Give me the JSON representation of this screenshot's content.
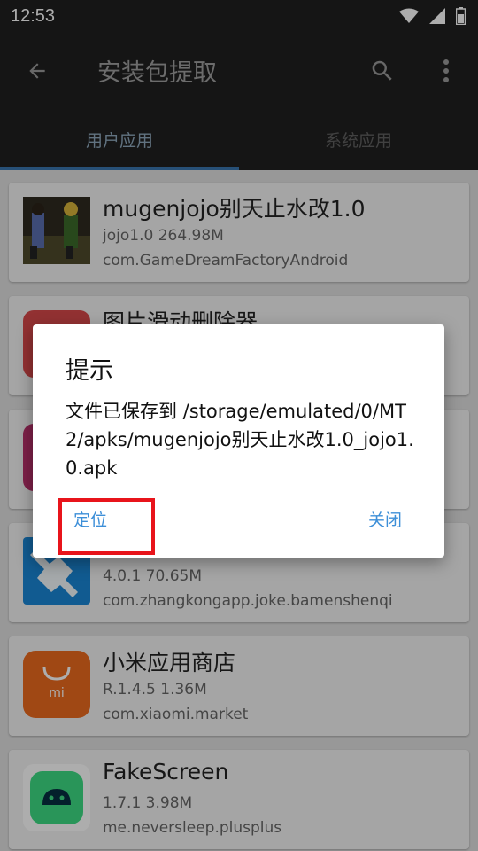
{
  "status_bar": {
    "time": "12:53"
  },
  "app_bar": {
    "title": "安装包提取",
    "back_icon": "arrow-back-icon",
    "search_icon": "search-icon",
    "more_icon": "more-vert-icon"
  },
  "tabs": [
    {
      "label": "用户应用",
      "active": true
    },
    {
      "label": "系统应用",
      "active": false
    }
  ],
  "apps": [
    {
      "title": "mugenjojo别天止水改1.0",
      "meta": "jojo1.0   264.98M",
      "package": "com.GameDreamFactoryAndroid"
    },
    {
      "title": "图片滑动删除器",
      "meta": "",
      "package": ""
    },
    {
      "title": "",
      "meta": "",
      "package": ""
    },
    {
      "title": "",
      "meta": "4.0.1   70.65M",
      "package": "com.zhangkongapp.joke.bamenshenqi"
    },
    {
      "title": "小米应用商店",
      "meta": "R.1.4.5   1.36M",
      "package": "com.xiaomi.market"
    },
    {
      "title": "FakeScreen",
      "meta": "1.7.1   3.98M",
      "package": "me.neversleep.plusplus"
    }
  ],
  "dialog": {
    "title": "提示",
    "message": "文件已保存到 /storage/emulated/0/MT2/apks/mugenjojo别天止水改1.0_jojo1.0.apk",
    "positive": "定位",
    "negative": "关闭"
  },
  "colors": {
    "accent": "#3d8fd8",
    "highlight": "#e8141b",
    "bar_bg": "#1f1f1f"
  }
}
